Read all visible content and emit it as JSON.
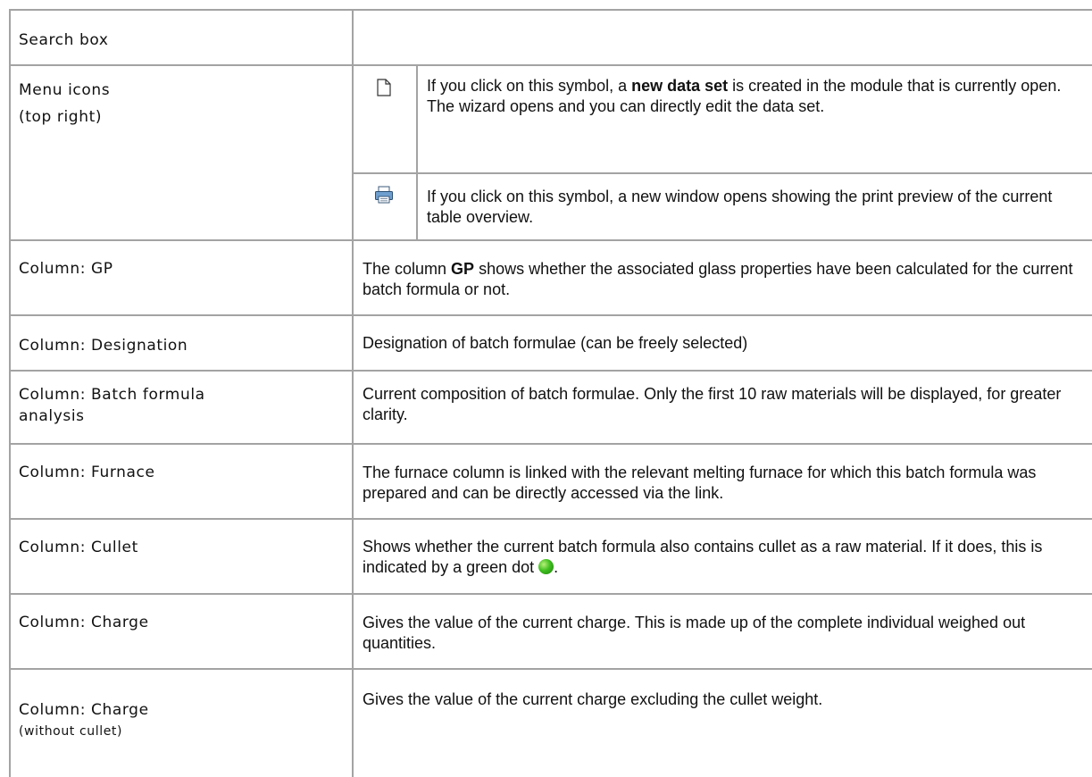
{
  "rows": {
    "search": {
      "label": "Search box"
    },
    "menu": {
      "label_line1": "Menu icons",
      "label_line2": "(top right)",
      "new_icon": "new-document-icon",
      "new_pre": "If you click on this symbol, a ",
      "new_bold": "new data set",
      "new_post": " is created in the module that is currently open. The wizard opens and you can directly edit the data set.",
      "print_icon": "printer-icon",
      "print_text": "If you click on this symbol, a new window opens showing the print preview of the current table overview."
    },
    "gp": {
      "label": "Column: GP",
      "pre": "The column ",
      "bold": "GP",
      "post": " shows whether the associated glass properties have been calculated for the current batch formula or not."
    },
    "designation": {
      "label": "Column: Designation",
      "text": "Designation of batch formulae (can be freely selected)"
    },
    "analysis": {
      "label_line1": "Column: Batch formula",
      "label_line2": "analysis",
      "text": "Current composition of batch formulae. Only the first 10 raw materials will be displayed, for greater clarity."
    },
    "furnace": {
      "label": "Column: Furnace",
      "text": "The furnace column is linked with the relevant melting furnace  for which this batch formula was prepared and can be directly accessed via the link."
    },
    "cullet": {
      "label": "Column: Cullet",
      "text": "Shows whether the current batch formula also contains cullet as a raw material. If it does, this is indicated by a green dot",
      "text_end": ".",
      "dot_icon": "green-dot-icon",
      "dot_color": "#3fbf1f"
    },
    "charge": {
      "label": "Column: Charge",
      "text": "Gives the value of the current charge. This is made up of the complete individual weighed out quantities."
    },
    "charge_no_cullet": {
      "label_line1": "Column: Charge",
      "label_line2": "(without cullet)",
      "text": "Gives the value of the current charge excluding the cullet weight."
    }
  },
  "colors": {
    "border": "#a3a3a3",
    "text": "#111111"
  }
}
